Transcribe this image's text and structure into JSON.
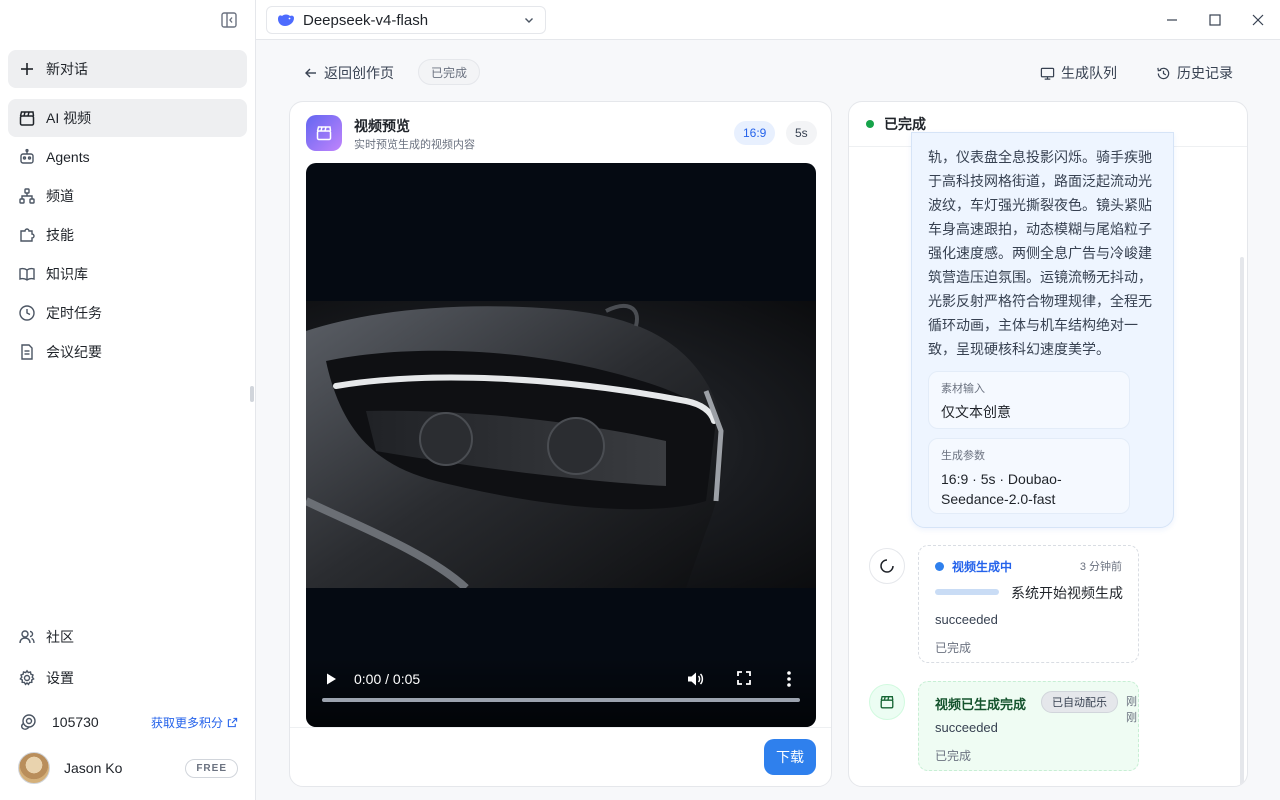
{
  "sidebar": {
    "new_chat": "新对话",
    "items": [
      {
        "label": "AI 视频",
        "icon": "clapperboard-icon"
      },
      {
        "label": "Agents",
        "icon": "robot-icon"
      },
      {
        "label": "频道",
        "icon": "sitemap-icon"
      },
      {
        "label": "技能",
        "icon": "puzzle-icon"
      },
      {
        "label": "知识库",
        "icon": "book-open-icon"
      },
      {
        "label": "定时任务",
        "icon": "clock-icon"
      },
      {
        "label": "会议纪要",
        "icon": "document-icon"
      }
    ],
    "community": "社区",
    "settings": "设置",
    "credits": "105730",
    "credits_link": "获取更多积分",
    "user_name": "Jason Ko",
    "plan": "FREE"
  },
  "topbar": {
    "model": "Deepseek-v4-flash"
  },
  "main": {
    "back": "返回创作页",
    "status": "已完成",
    "queue": "生成队列",
    "history": "历史记录"
  },
  "preview": {
    "title": "视频预览",
    "subtitle": "实时预览生成的视频内容",
    "ratio": "16:9",
    "duration": "5s",
    "time": "0:00 / 0:05",
    "progress": 0,
    "download": "下载"
  },
  "status_panel": {
    "title": "已完成",
    "prompt": "轨，仪表盘全息投影闪烁。骑手疾驰于高科技网格街道，路面泛起流动光波纹，车灯强光撕裂夜色。镜头紧贴车身高速跟拍，动态模糊与尾焰粒子强化速度感。两侧全息广告与冷峻建筑营造压迫氛围。运镜流畅无抖动，光影反射严格符合物理规律，全程无循环动画，主体与机车结构绝对一致，呈现硬核科幻速度美学。",
    "material_label": "素材输入",
    "material_value": "仅文本创意",
    "params_label": "生成参数",
    "params_value": "16:9 · 5s · Doubao-Seedance-2.0-fast",
    "event1": {
      "title": "视频生成中",
      "time": "3 分钟前",
      "message": "系统开始视频生成",
      "status": "succeeded",
      "done": "已完成"
    },
    "event2": {
      "title": "视频已生成完成",
      "badge": "已自动配乐",
      "time": "刚刚",
      "status": "succeeded",
      "done": "已完成"
    }
  },
  "colors": {
    "accent": "#2f80ed",
    "success": "#16a34a",
    "video_bg": "#050a12"
  }
}
